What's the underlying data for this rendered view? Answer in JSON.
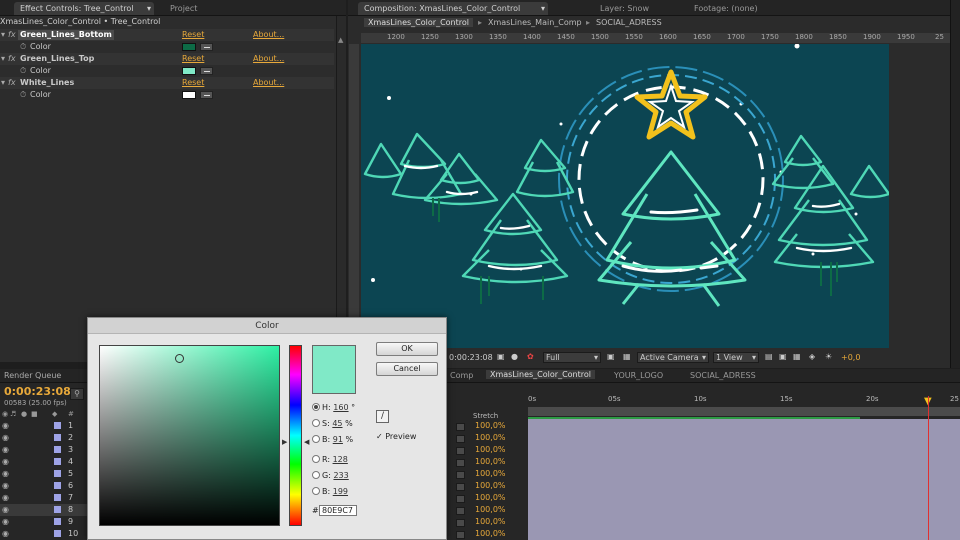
{
  "effect_controls": {
    "tab_label": "Effect Controls: Tree_Control",
    "project_tab": "Project",
    "breadcrumb": "XmasLines_Color_Control • Tree_Control",
    "effects": [
      {
        "name": "Green_Lines_Bottom",
        "reset": "Reset",
        "about": "About...",
        "prop": "Color",
        "color": "#0d6b46"
      },
      {
        "name": "Green_Lines_Top",
        "reset": "Reset",
        "about": "About...",
        "prop": "Color",
        "color": "#80e9c7"
      },
      {
        "name": "White_Lines",
        "reset": "Reset",
        "about": "About...",
        "prop": "Color",
        "color": "#ffffff"
      }
    ]
  },
  "composition": {
    "tab_label": "Composition: XmasLines_Color_Control",
    "layer_tab": "Layer: Snow",
    "footage_tab": "Footage: (none)",
    "crumbs": [
      "XmasLines_Color_Control",
      "XmasLines_Main_Comp",
      "SOCIAL_ADRESS"
    ],
    "ruler": [
      "1200",
      "1250",
      "1300",
      "1350",
      "1400",
      "1450",
      "1500",
      "1550",
      "1600",
      "1650",
      "1700",
      "1750",
      "1800",
      "1850",
      "1900",
      "1950",
      "25"
    ],
    "timecode": "0:00:23:08",
    "resolution": "Full",
    "camera": "Active Camera",
    "view": "1 View",
    "exposure": "+0,0"
  },
  "timeline": {
    "render_queue": "Render Queue",
    "timecode": "0:00:23:08",
    "frames": "00583 (25.00 fps)",
    "tabs": [
      "Comp",
      "XmasLines_Color_Control",
      "YOUR_LOGO",
      "SOCIAL_ADRESS"
    ],
    "stretch_header": "Stretch",
    "time_ticks": [
      "0s",
      "05s",
      "10s",
      "15s",
      "20s",
      "25"
    ],
    "layers": [
      {
        "num": "1",
        "stretch": "100,0%"
      },
      {
        "num": "2",
        "stretch": "100,0%"
      },
      {
        "num": "3",
        "stretch": "100,0%"
      },
      {
        "num": "4",
        "stretch": "100,0%"
      },
      {
        "num": "5",
        "stretch": "100,0%"
      },
      {
        "num": "6",
        "stretch": "100,0%"
      },
      {
        "num": "7",
        "stretch": "100,0%"
      },
      {
        "num": "8",
        "stretch": "100,0%"
      },
      {
        "num": "9",
        "stretch": "100,0%"
      },
      {
        "num": "10",
        "stretch": "100,0%"
      }
    ]
  },
  "color_dialog": {
    "title": "Color",
    "ok": "OK",
    "cancel": "Cancel",
    "preview_label": "Preview",
    "preview_checked": true,
    "swatch_color": "#80e9c7",
    "h_label": "H:",
    "h_value": "160",
    "h_unit": "°",
    "s_label": "S:",
    "s_value": "45",
    "s_unit": "%",
    "b_label": "B:",
    "b_value": "91",
    "b_unit": "%",
    "r_label": "R:",
    "r_value": "128",
    "g_label": "G:",
    "g_value": "233",
    "bb_label": "B:",
    "bb_value": "199",
    "hex_value": "80E9C7"
  }
}
